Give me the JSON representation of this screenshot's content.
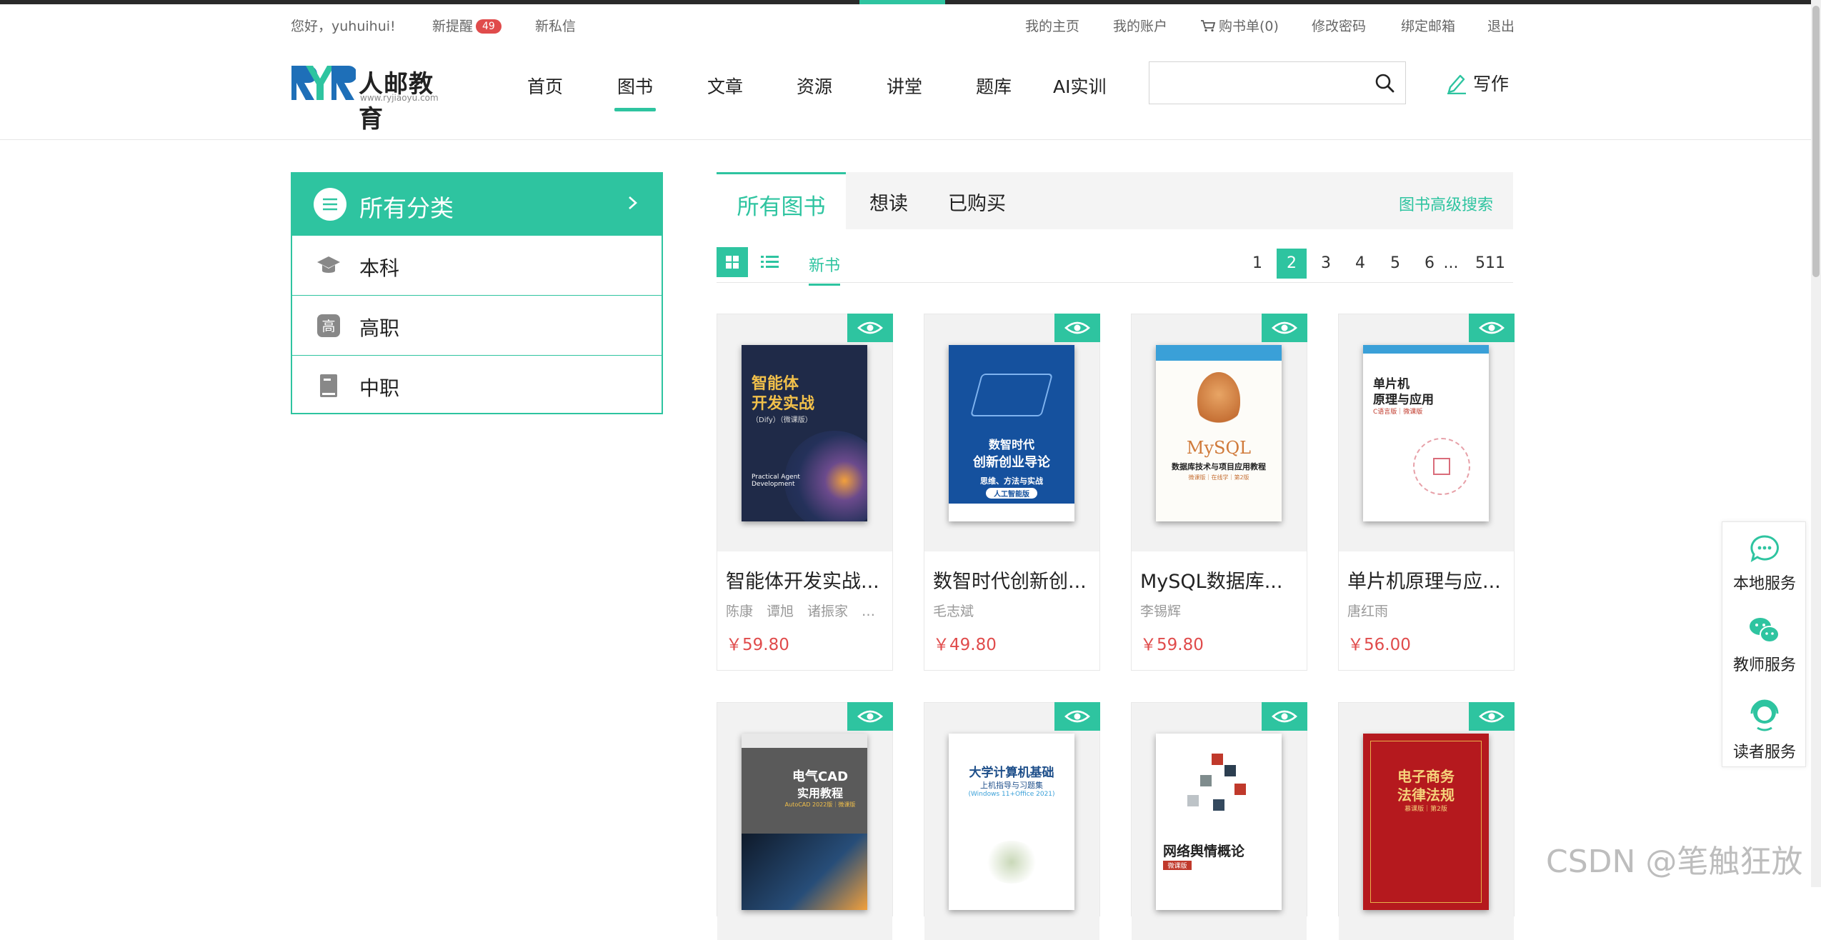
{
  "topbar": {
    "greeting": "您好，yuhuihui!",
    "new_alerts_label": "新提醒",
    "new_alerts_count": "49",
    "new_messages": "新私信",
    "my_home": "我的主页",
    "my_account": "我的账户",
    "cart": "购书单(0)",
    "change_password": "修改密码",
    "bind_email": "绑定邮箱",
    "logout": "退出"
  },
  "header": {
    "logo_text": "人邮教育",
    "logo_url": "www.ryjiaoyu.com",
    "nav": [
      "首页",
      "图书",
      "文章",
      "资源",
      "讲堂",
      "题库",
      "AI实训"
    ],
    "active_nav": "图书",
    "search_placeholder": "",
    "write_label": "写作"
  },
  "sidebar": {
    "header": "所有分类",
    "items": [
      {
        "label": "本科",
        "icon": "graduation-cap-icon"
      },
      {
        "label": "高职",
        "icon": "gao-badge-icon"
      },
      {
        "label": "中职",
        "icon": "book-icon"
      }
    ]
  },
  "main": {
    "tabs": [
      "所有图书",
      "想读",
      "已购买"
    ],
    "active_tab": "所有图书",
    "advanced_search": "图书高级搜索",
    "filter_label": "新书",
    "pagination": [
      "1",
      "2",
      "3",
      "4",
      "5",
      "6",
      "...",
      "511"
    ],
    "current_page": "2"
  },
  "books": [
    {
      "title": "智能体开发实战...",
      "author": "陈康　谭旭　诸振家　余...",
      "price": "￥59.80",
      "cover_lines": [
        "智能体",
        "开发实战",
        "（Dify）（微课版）",
        "Practical Agent Development"
      ]
    },
    {
      "title": "数智时代创新创...",
      "author": "毛志斌",
      "price": "￥49.80",
      "cover_lines": [
        "数智时代",
        "创新创业导论",
        "思维、方法与实战",
        "人工智能版"
      ]
    },
    {
      "title": "MySQL数据库...",
      "author": "李锡辉",
      "price": "￥59.80",
      "cover_lines": [
        "MySQL",
        "数据库技术与项目应用教程",
        "微课版｜在线学｜第2版"
      ]
    },
    {
      "title": "单片机原理与应...",
      "author": "唐红雨",
      "price": "￥56.00",
      "cover_lines": [
        "单片机",
        "原理与应用",
        "C语言版｜微课版"
      ]
    },
    {
      "title": "",
      "author": "",
      "price": "",
      "cover_lines": [
        "电气CAD",
        "实用教程",
        "AutoCAD 2022版｜微课版"
      ]
    },
    {
      "title": "",
      "author": "",
      "price": "",
      "cover_lines": [
        "大学计算机基础",
        "上机指导与习题集",
        "(Windows 11+Office 2021)"
      ]
    },
    {
      "title": "",
      "author": "",
      "price": "",
      "cover_lines": [
        "网络舆情概论",
        "微课版"
      ]
    },
    {
      "title": "",
      "author": "",
      "price": "",
      "cover_lines": [
        "电子商务",
        "法律法规",
        "慕课版｜第2版"
      ]
    }
  ],
  "service": {
    "items": [
      "本地服务",
      "教师服务",
      "读者服务"
    ]
  },
  "watermark": "CSDN @笔触狂放",
  "colors": {
    "accent": "#2ec4a0",
    "price": "#e04b4b",
    "badge": "#e04b4b"
  }
}
